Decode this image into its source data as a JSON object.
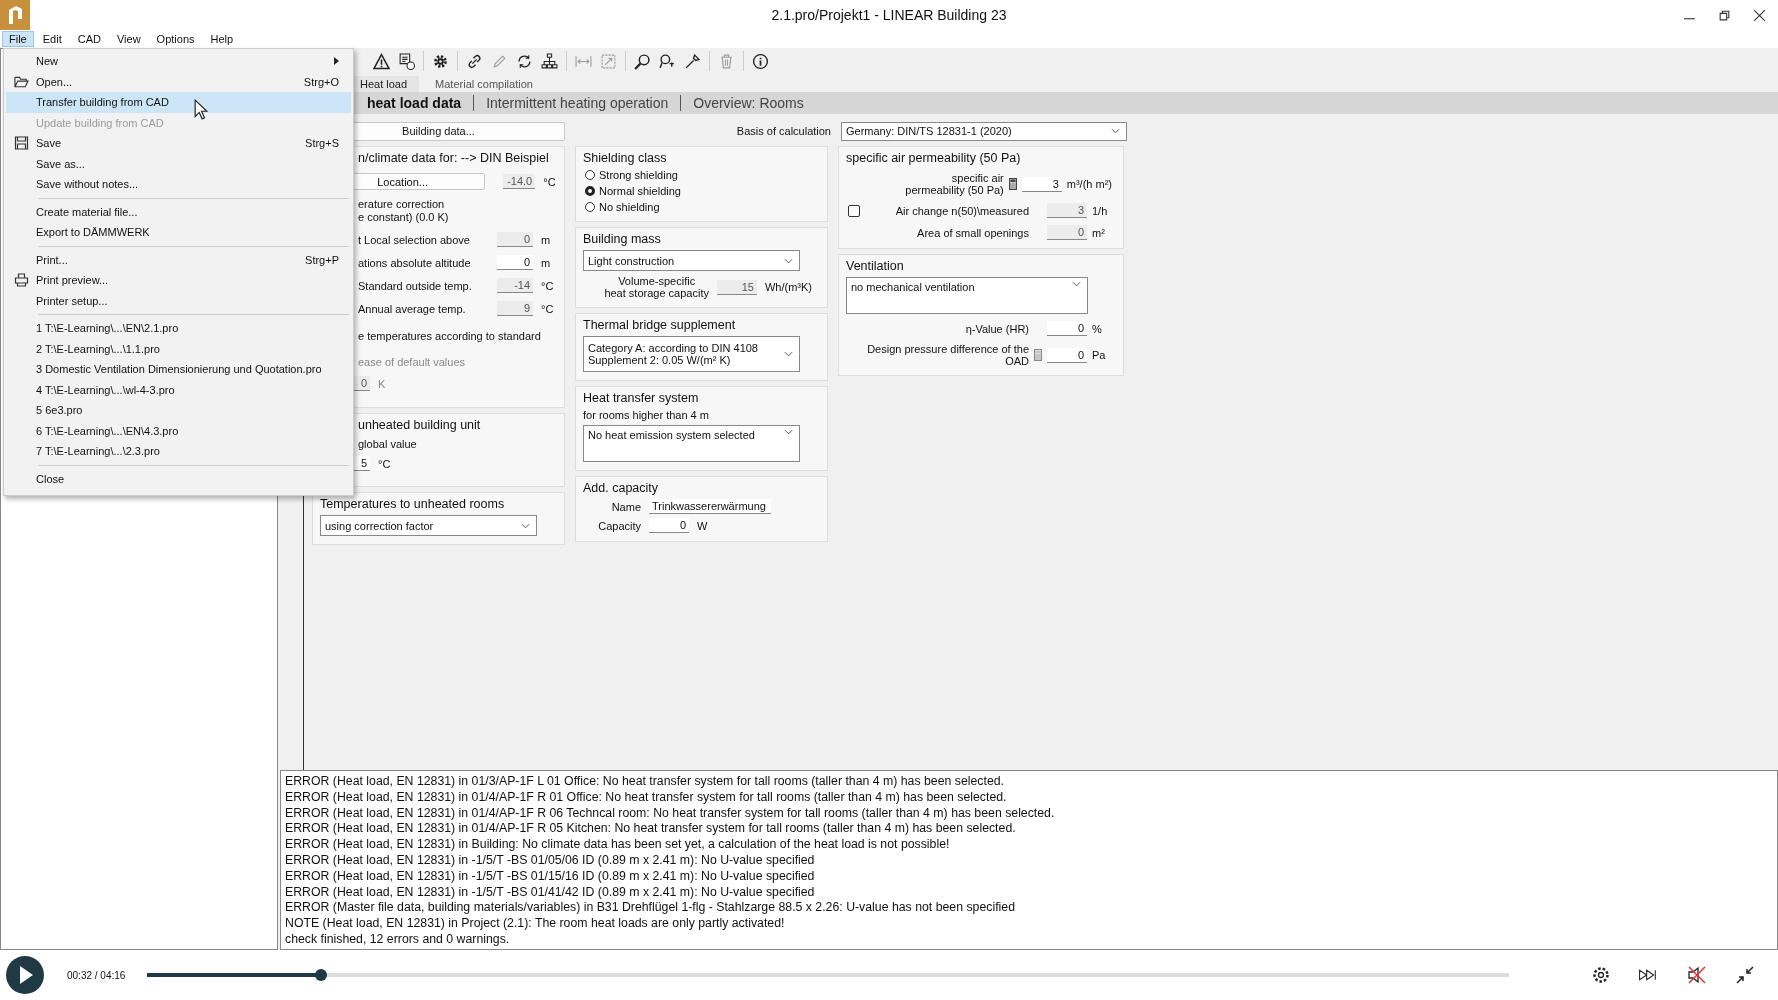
{
  "window": {
    "title": "2.1.pro/Projekt1 - LINEAR Building 23"
  },
  "menubar": [
    {
      "label": "File",
      "selected": true
    },
    {
      "label": "Edit",
      "selected": false
    },
    {
      "label": "CAD",
      "selected": false
    },
    {
      "label": "View",
      "selected": false
    },
    {
      "label": "Options",
      "selected": false
    },
    {
      "label": "Help",
      "selected": false
    }
  ],
  "file_menu": [
    {
      "kind": "submenu",
      "label": "New",
      "selected": false,
      "disabled": false
    },
    {
      "kind": "item",
      "label": "Open...",
      "shortcut": "Strg+O",
      "selected": false,
      "disabled": false
    },
    {
      "kind": "item",
      "label": "Transfer building from CAD",
      "selected": true,
      "disabled": false
    },
    {
      "kind": "item",
      "label": "Update building from CAD",
      "selected": false,
      "disabled": true
    },
    {
      "kind": "item",
      "label": "Save",
      "shortcut": "Strg+S",
      "selected": false,
      "disabled": false
    },
    {
      "kind": "item",
      "label": "Save as...",
      "selected": false,
      "disabled": false
    },
    {
      "kind": "item",
      "label": "Save without notes...",
      "selected": false,
      "disabled": false
    },
    {
      "kind": "separator"
    },
    {
      "kind": "item",
      "label": "Create material file...",
      "selected": false,
      "disabled": false
    },
    {
      "kind": "item",
      "label": "Export to DÄMMWERK",
      "selected": false,
      "disabled": false
    },
    {
      "kind": "separator"
    },
    {
      "kind": "item",
      "label": "Print...",
      "shortcut": "Strg+P",
      "selected": false,
      "disabled": false
    },
    {
      "kind": "item",
      "label": "Print preview...",
      "selected": false,
      "disabled": false
    },
    {
      "kind": "item",
      "label": "Printer setup...",
      "selected": false,
      "disabled": false
    },
    {
      "kind": "separator"
    },
    {
      "kind": "item",
      "label": "1 T:\\E-Learning\\...\\EN\\2.1.pro",
      "selected": false,
      "disabled": false
    },
    {
      "kind": "item",
      "label": "2 T:\\E-Learning\\...\\1.1.pro",
      "selected": false,
      "disabled": false
    },
    {
      "kind": "item",
      "label": "3 Domestic Ventilation Dimensionierung und Quotation.pro",
      "selected": false,
      "disabled": false
    },
    {
      "kind": "item",
      "label": "4 T:\\E-Learning\\...\\wl-4-3.pro",
      "selected": false,
      "disabled": false
    },
    {
      "kind": "item",
      "label": "5 6e3.pro",
      "selected": false,
      "disabled": false
    },
    {
      "kind": "item",
      "label": "6 T:\\E-Learning\\...\\EN\\4.3.pro",
      "selected": false,
      "disabled": false
    },
    {
      "kind": "item",
      "label": "7 T:\\E-Learning\\...\\2.3.pro",
      "selected": false,
      "disabled": false
    },
    {
      "kind": "separator"
    },
    {
      "kind": "item",
      "label": "Close",
      "selected": false,
      "disabled": false
    }
  ],
  "tabs": [
    {
      "label": "Heat load",
      "selected": true
    },
    {
      "label": "Material compilation",
      "selected": false
    }
  ],
  "subtabs": [
    {
      "label": "heat load data",
      "selected": true
    },
    {
      "label": "Intermittent heating operation",
      "selected": false
    },
    {
      "label": "Overview: Rooms",
      "selected": false
    }
  ],
  "building_data_button": "Building data...",
  "basis": {
    "label": "Basis of calculation",
    "value": "Germany: DIN/TS 12831-1 (2020)"
  },
  "climate": {
    "title": "n/climate data for: --> DIN Beispiel",
    "location_button": "Location...",
    "location_temp": {
      "value": "-14.0",
      "unit": "°C",
      "disabled": true
    },
    "correction": "erature correction\ne constant) (0.0 K)",
    "rows": [
      {
        "label": "t Local selection above",
        "value": "0",
        "unit": "m",
        "disabled": true
      },
      {
        "label": "ations absolute altitude",
        "value": "0",
        "unit": "m",
        "disabled": false
      },
      {
        "label": "Standard outside temp.",
        "value": "-14",
        "unit": "°C",
        "disabled": true
      },
      {
        "label": "Annual average temp.",
        "value": "9",
        "unit": "°C",
        "disabled": true
      }
    ],
    "standard_option": "e temperatures according to standard",
    "default_values": "ease of default values",
    "default_field": {
      "value": "0",
      "unit": "K",
      "disabled": true
    }
  },
  "unheated_unit": {
    "title": "unheated building unit",
    "option": "global value",
    "field": {
      "value": "5",
      "unit": "°C",
      "disabled": false
    }
  },
  "unheated_rooms": {
    "title": "Temperatures to unheated rooms",
    "value": "using correction factor"
  },
  "shielding": {
    "title": "Shielding class",
    "options": [
      {
        "label": "Strong shielding",
        "selected": false
      },
      {
        "label": "Normal shielding",
        "selected": true
      },
      {
        "label": "No shielding",
        "selected": false
      }
    ]
  },
  "building_mass": {
    "title": "Building mass",
    "value": "Light construction",
    "capacity_label": "Volume-specific\nheat storage capacity",
    "capacity": {
      "value": "15",
      "unit": "Wh/(m³K)",
      "disabled": true
    }
  },
  "thermal_bridge": {
    "title": "Thermal bridge supplement",
    "value": "Category A: according to DIN 4108\nSupplement 2: 0.05 W/(m² K)"
  },
  "heat_transfer": {
    "title": "Heat transfer system",
    "subtitle": "for rooms higher than 4 m",
    "value": "No heat emission system selected"
  },
  "add_capacity": {
    "title": "Add. capacity",
    "name_label": "Name",
    "name_value": "Trinkwassererwärmung",
    "capacity_label": "Capacity",
    "capacity": {
      "value": "0",
      "unit": "W",
      "disabled": false
    }
  },
  "air_permeability": {
    "title": "specific air permeability (50 Pa)",
    "rows": [
      {
        "kind": "calc",
        "label": "specific air\npermeability (50 Pa)",
        "value": "3",
        "unit": "m³/(h m²)",
        "disabled": false
      },
      {
        "kind": "checkbox",
        "checked": false,
        "label": "Air change n(50)\\measured",
        "value": "3",
        "unit": "1/h",
        "disabled": true
      },
      {
        "kind": "plain",
        "label": "Area of small openings",
        "value": "0",
        "unit": "m²",
        "disabled": true
      }
    ]
  },
  "ventilation": {
    "title": "Ventilation",
    "value": "no mechanical ventilation",
    "rows": [
      {
        "kind": "plain",
        "label": "η-Value (HR)",
        "value": "0",
        "unit": "%",
        "disabled": false
      },
      {
        "kind": "calc",
        "label": "Design pressure difference of the\nOAD",
        "value": "0",
        "unit": "Pa",
        "disabled": false
      }
    ]
  },
  "log": [
    "ERROR (Heat load, EN 12831) in 01/3/AP-1F L 01 Office: No heat transfer system for tall rooms (taller than 4 m) has been selected.",
    "ERROR (Heat load, EN 12831) in 01/4/AP-1F R 01 Office: No heat transfer system for tall rooms (taller than 4 m) has been selected.",
    "ERROR (Heat load, EN 12831) in 01/4/AP-1F R 06 Techncal room: No heat transfer system for tall rooms (taller than 4 m) has been selected.",
    "ERROR (Heat load, EN 12831) in 01/4/AP-1F R 05 Kitchen: No heat transfer system for tall rooms (taller than 4 m) has been selected.",
    "ERROR (Heat load, EN 12831) in Building: No climate data has been set yet, a calculation of the heat load is not possible!",
    "ERROR (Heat load, EN 12831) in -1/5/T -BS 01/05/06 ID (0.89 m x 2.41 m): No U-value specified",
    "ERROR (Heat load, EN 12831) in -1/5/T -BS 01/15/16 ID (0.89 m x 2.41 m): No U-value specified",
    "ERROR (Heat load, EN 12831) in -1/5/T -BS 01/41/42 ID (0.89 m x 2.41 m): No U-value specified",
    "ERROR (Master file data, building materials/variables) in B31 Drehflügel 1-flg - Stahlzarge 88.5 x 2.26: U-value has not been specified",
    "NOTE (Heat load, EN 12831) in Project (2.1): The room heat loads are only partly activated!",
    "check finished, 12 errors and 0 warnings."
  ],
  "player": {
    "time": "00:32 / 04:16",
    "level": 0.128
  }
}
